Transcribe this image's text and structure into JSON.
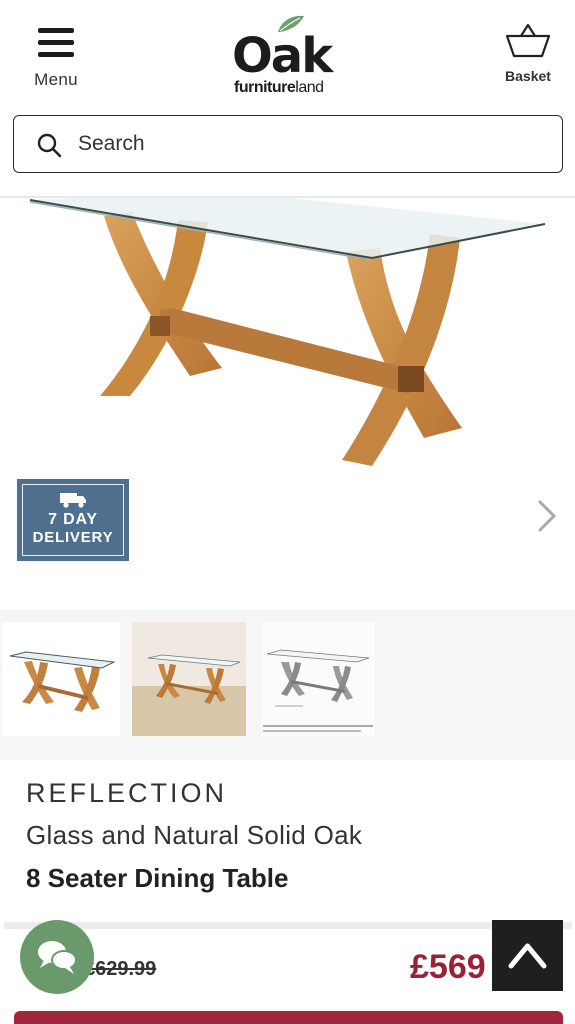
{
  "header": {
    "menu_label": "Menu",
    "menu_icon": "hamburger-icon",
    "logo_main": "Oak",
    "logo_sub_bold": "furniture",
    "logo_sub_light": "land",
    "basket_label": "Basket",
    "basket_icon": "basket-icon"
  },
  "search": {
    "placeholder": "Search",
    "icon": "search-icon"
  },
  "gallery": {
    "next_icon": "chevron-right-icon",
    "delivery_line1": "7 DAY",
    "delivery_line2": "DELIVERY",
    "delivery_color": "#4f6f8f",
    "thumbnails": [
      "thumbnail-product",
      "thumbnail-room",
      "thumbnail-dimensions"
    ]
  },
  "product": {
    "collection": "REFLECTION",
    "description": "Glass and Natural Solid Oak",
    "model": "8 Seater Dining Table"
  },
  "pricing": {
    "was_price": "£629.99",
    "now_price": "£569",
    "price_color": "#9b2235"
  },
  "floating": {
    "chat_icon": "chat-icon",
    "chat_color": "#6a9a6c",
    "scroll_top_icon": "chevron-up-icon"
  }
}
